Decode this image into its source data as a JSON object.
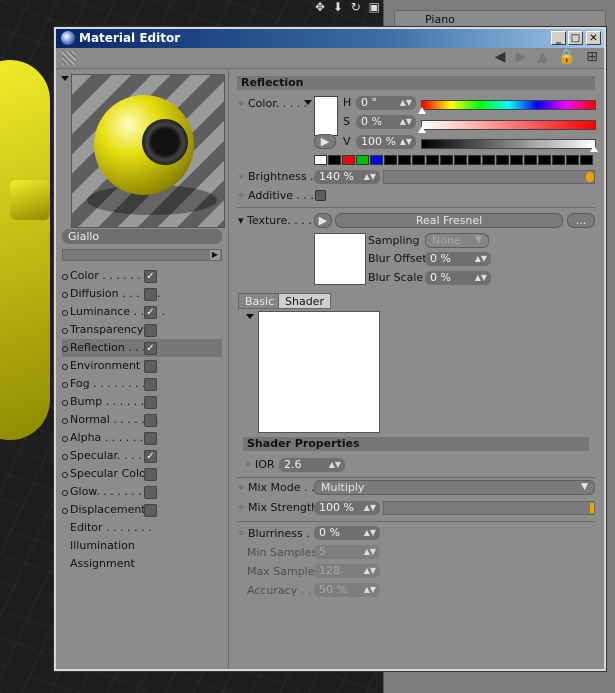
{
  "background": {
    "object_row_label": "Piano"
  },
  "window": {
    "title": "Material Editor",
    "buttons": {
      "minimize": "_",
      "maximize": "□",
      "close": "✕"
    }
  },
  "left": {
    "material_name": "Giallo",
    "channels": [
      {
        "label": "Color . . . . . . . .",
        "checked": true,
        "selected": false
      },
      {
        "label": "Diffusion . . . . . .",
        "checked": false,
        "selected": false
      },
      {
        "label": "Luminance . . . . .",
        "checked": true,
        "selected": false
      },
      {
        "label": "Transparency",
        "checked": false,
        "selected": false
      },
      {
        "label": "Reflection . . . .",
        "checked": true,
        "selected": true
      },
      {
        "label": "Environment",
        "checked": false,
        "selected": false
      },
      {
        "label": "Fog . . . . . . . . .",
        "checked": false,
        "selected": false
      },
      {
        "label": "Bump . . . . . . . .",
        "checked": false,
        "selected": false
      },
      {
        "label": "Normal . . . . . . .",
        "checked": false,
        "selected": false
      },
      {
        "label": "Alpha . . . . . . . .",
        "checked": false,
        "selected": false
      },
      {
        "label": "Specular. . . . . .",
        "checked": true,
        "selected": false
      },
      {
        "label": "Specular Color",
        "checked": false,
        "selected": false
      },
      {
        "label": "Glow. . . . . . . . .",
        "checked": false,
        "selected": false
      },
      {
        "label": "Displacement",
        "checked": false,
        "selected": false
      }
    ],
    "extra_items": [
      "Editor . . . . . . .",
      "Illumination",
      "Assignment"
    ]
  },
  "reflection": {
    "header": "Reflection",
    "color_label": "Color. . . . .",
    "h_label": "H",
    "h_value": "0 °",
    "s_label": "S",
    "s_value": "0 %",
    "v_label": "V",
    "v_value": "100 %",
    "brightness_label": "Brightness . .",
    "brightness_value": "140 %",
    "brightness_level": 1.0,
    "additive_label": "Additive . . . .",
    "texture_label": "Texture. . . . .",
    "texture_name": "Real Fresnel",
    "texture_more": "...",
    "sampling_label": "Sampling",
    "sampling_value": "None",
    "blur_offset_label": "Blur Offset",
    "blur_offset_value": "0 %",
    "blur_scale_label": "Blur Scale",
    "blur_scale_value": "0 %",
    "tab_basic": "Basic",
    "tab_shader": "Shader",
    "shader_props_header": "Shader Properties",
    "ior_label": "IOR",
    "ior_value": "2.6",
    "mix_mode_label": "Mix Mode . . .",
    "mix_mode_value": "Multiply",
    "mix_strength_label": "Mix Strength",
    "mix_strength_value": "100 %",
    "mix_strength_level": 1.0,
    "blurriness_label": "Blurriness . . .",
    "blurriness_value": "0 %",
    "min_samples_label": "Min Samples",
    "min_samples_value": "5",
    "max_samples_label": "Max Samples",
    "max_samples_value": "128",
    "accuracy_label": "Accuracy . . .",
    "accuracy_value": "50 %"
  },
  "colors": {
    "palette": [
      "#ffffff",
      "#000000",
      "#ff0000",
      "#00c000",
      "#0000ff",
      "#000000",
      "#000000",
      "#000000",
      "#000000",
      "#000000",
      "#000000",
      "#000000",
      "#000000",
      "#000000",
      "#000000",
      "#000000",
      "#000000",
      "#000000",
      "#000000",
      "#000000"
    ],
    "brightness_fill": "#f0a000",
    "title_gradient_start": "#0a246a"
  }
}
